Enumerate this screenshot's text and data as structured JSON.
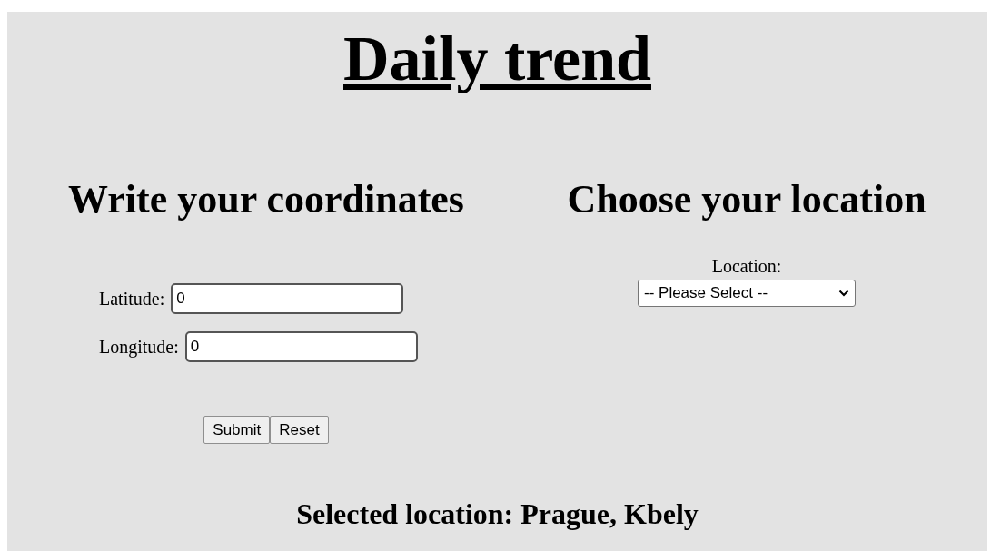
{
  "title": "Daily trend",
  "coordinates": {
    "heading": "Write your coordinates",
    "fields": [
      {
        "label": "Latitude:",
        "value": "0"
      },
      {
        "label": "Longitude:",
        "value": "0"
      }
    ],
    "buttons": [
      "Submit",
      "Reset"
    ]
  },
  "location": {
    "heading": "Choose your location",
    "label": "Location:",
    "select": "-- Please Select --"
  },
  "selected_location": "Selected location: Prague, Kbely"
}
